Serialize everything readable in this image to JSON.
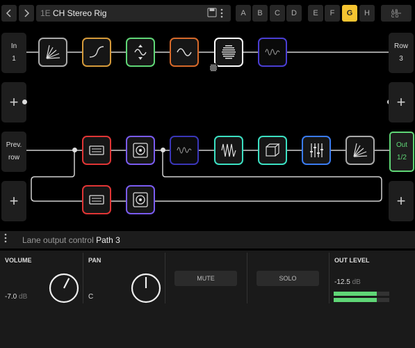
{
  "header": {
    "nav_back_icon": "chevron-left",
    "nav_forward_icon": "chevron-right",
    "preset_id": "1E",
    "preset_name": "CH Stereo Rig",
    "save_icon": "floppy",
    "menu_icon": "vertical-ellipsis",
    "slots": [
      "A",
      "B",
      "C",
      "D",
      "E",
      "F",
      "G",
      "H"
    ],
    "active_slot": "G",
    "compare_icon": "ab-compare"
  },
  "grid": {
    "in": {
      "label": "In",
      "num": "1"
    },
    "row": {
      "label": "Row",
      "num": "3"
    },
    "prev": {
      "label1": "Prev.",
      "label2": "row"
    },
    "out": {
      "label": "Out",
      "num": "1/2"
    },
    "plus": "+",
    "row1_blocks": [
      {
        "icon": "reverb-icon",
        "color": "#aaaaaa"
      },
      {
        "icon": "filter-icon",
        "color": "#d59a3a"
      },
      {
        "icon": "modulation-icon",
        "color": "#5fd676"
      },
      {
        "icon": "wave-icon",
        "color": "#d6692a"
      },
      {
        "icon": "striped-icon",
        "color": "#ffffff"
      },
      {
        "icon": "wave-icon",
        "color": "#4a3ed3"
      }
    ],
    "row3_blocks": [
      {
        "icon": "amp-icon",
        "color": "#e03535"
      },
      {
        "icon": "cab-icon",
        "color": "#7a5bf0"
      },
      {
        "icon": "wave-icon",
        "color": "#3a36b8"
      },
      {
        "icon": "wave-icon",
        "color": "#3be0c2"
      },
      {
        "icon": "cube-icon",
        "color": "#3be0c2"
      },
      {
        "icon": "eq-icon",
        "color": "#3a7bf0"
      },
      {
        "icon": "reverb-icon",
        "color": "#aaaaaa"
      }
    ],
    "row4_blocks": [
      {
        "icon": "amp-icon",
        "color": "#e03535"
      },
      {
        "icon": "cab-icon",
        "color": "#7a5bf0"
      }
    ]
  },
  "lane_bar": {
    "menu_icon": "vertical-ellipsis",
    "label": "Lane output control",
    "path": "Path 3"
  },
  "panel": {
    "volume": {
      "label": "VOLUME",
      "value": "-7.0",
      "unit": "dB",
      "knob_level": 0.6
    },
    "pan": {
      "label": "PAN",
      "value": "C",
      "knob_level": 0.5
    },
    "mute": {
      "label": "MUTE"
    },
    "solo": {
      "label": "SOLO"
    },
    "out_level": {
      "label": "OUT LEVEL",
      "value": "-12.5",
      "unit": "dB",
      "meter_left": 0.77,
      "meter_right": 0.77
    }
  },
  "colors": {
    "accent": "#f5c431",
    "meter": "#5fd676"
  }
}
